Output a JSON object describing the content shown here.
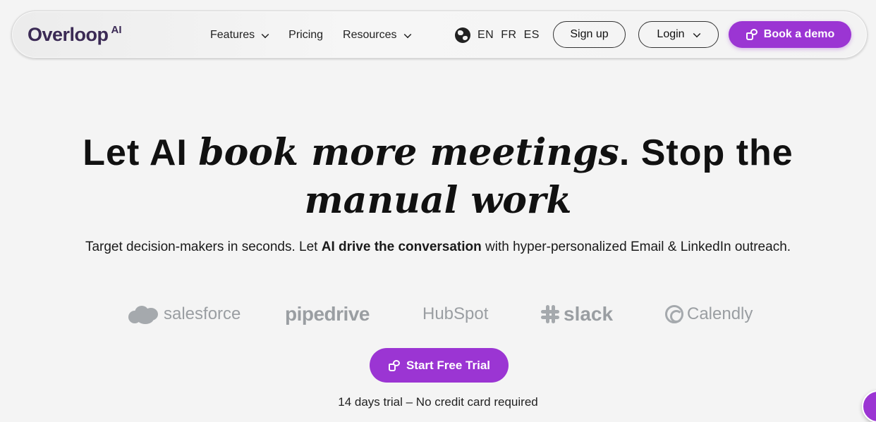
{
  "nav": {
    "logo_word": "Overloop",
    "logo_suffix": "AI",
    "links": [
      {
        "label": "Features"
      },
      {
        "label": "Pricing"
      },
      {
        "label": "Resources"
      }
    ],
    "languages": [
      "EN",
      "FR",
      "ES"
    ],
    "signup_label": "Sign up",
    "login_label": "Login",
    "demo_label": "Book a demo"
  },
  "hero": {
    "line1_pre": "Let AI ",
    "line1_em": "book more meetings",
    "line1_post": ". Stop the",
    "line2_em": "manual work",
    "sub_pre": "Target decision-makers in seconds. Let ",
    "sub_bold": "AI drive the conversation",
    "sub_post": " with hyper-personalized Email & LinkedIn outreach."
  },
  "integrations": {
    "salesforce": "salesforce",
    "pipedrive": "pipedrive",
    "hubspot": "HubSpot",
    "slack": "slack",
    "calendly": "Calendly"
  },
  "cta": {
    "trial_label": "Start Free Trial",
    "trial_note": "14 days trial – No credit card required"
  },
  "colors": {
    "brand_purple": "#9b35d3",
    "logo_color": "#3b2a55",
    "background": "#f4f4f4",
    "integration_gray": "#9a9ea2"
  }
}
